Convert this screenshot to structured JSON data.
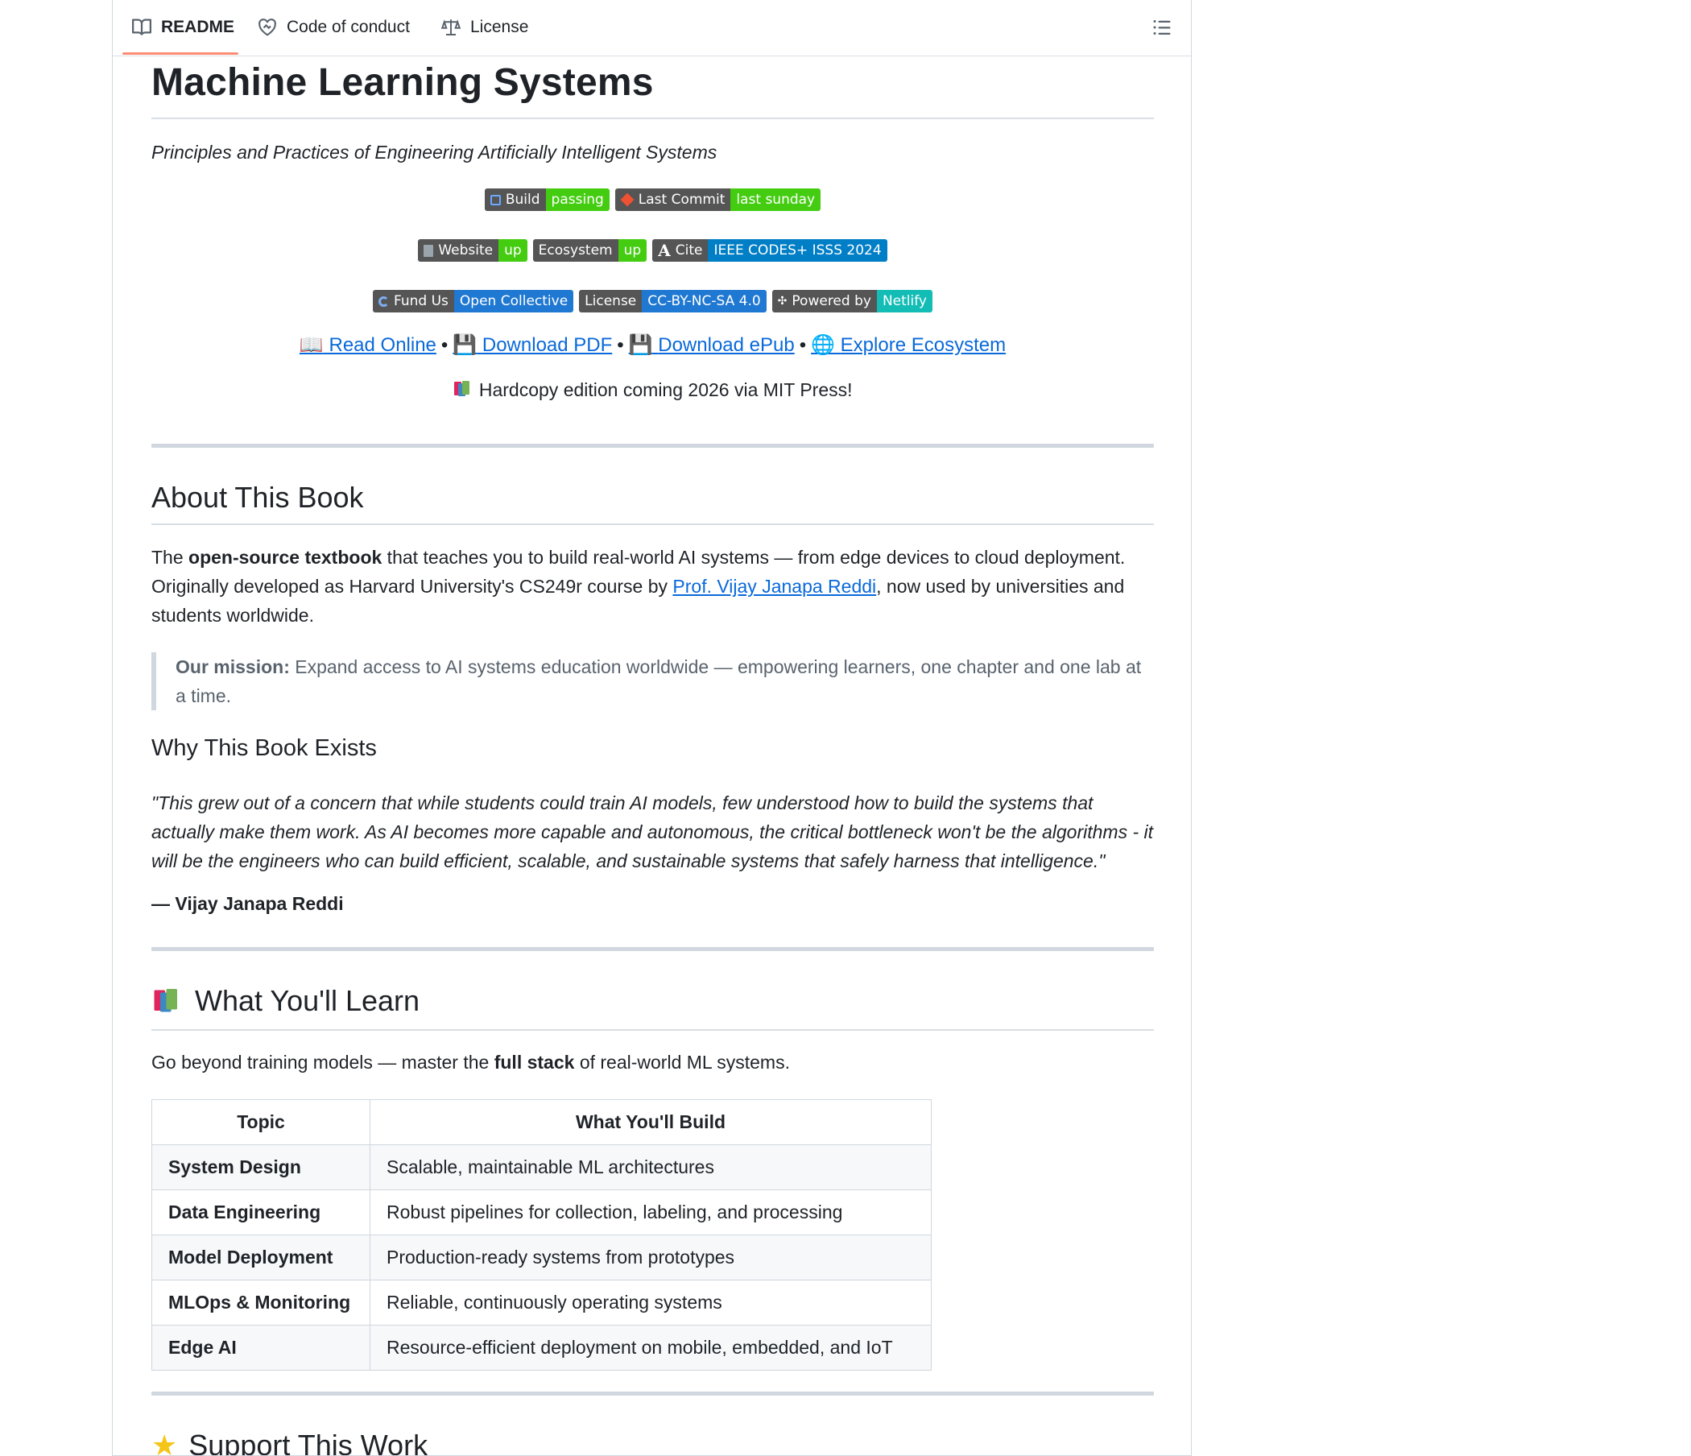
{
  "tabs": [
    {
      "label": "README",
      "icon": "book-icon",
      "active": true
    },
    {
      "label": "Code of conduct",
      "icon": "heart-handshake-icon",
      "active": false
    },
    {
      "label": "License",
      "icon": "law-scale-icon",
      "active": false
    }
  ],
  "readme": {
    "title": "Machine Learning Systems",
    "subtitle": "Principles and Practices of Engineering Artificially Intelligent Systems",
    "badges": {
      "row1": [
        {
          "label": "Build",
          "value": "passing",
          "color": "#4c1"
        },
        {
          "label": "Last Commit",
          "value": "last sunday",
          "color": "#4c1"
        }
      ],
      "row2": [
        {
          "label": "Website",
          "value": "up",
          "color": "#4c1"
        },
        {
          "label": "Ecosystem",
          "value": "up",
          "color": "#4c1"
        },
        {
          "label": "Cite",
          "value": "IEEE CODES+ ISSS 2024",
          "color": "#007ec6"
        }
      ],
      "row3": [
        {
          "label": "Fund Us",
          "value": "Open Collective",
          "color": "#1f78d1"
        },
        {
          "label": "License",
          "value": "CC-BY-NC-SA 4.0",
          "color": "#1f78d1"
        },
        {
          "label": "Powered by",
          "value": "Netlify",
          "color": "#13bdb6"
        }
      ]
    },
    "links": {
      "read_online": "Read Online",
      "download_pdf": "Download PDF",
      "download_epub": "Download ePub",
      "explore": "Explore Ecosystem",
      "separator": "•"
    },
    "hardcopy": "Hardcopy edition coming 2026 via MIT Press!",
    "about": {
      "heading": "About This Book",
      "p_the": "The ",
      "p_bold": "open-source textbook",
      "p_rest1": " that teaches you to build real-world AI systems — from edge devices to cloud deployment. Originally developed as Harvard University's CS249r course by ",
      "p_link": "Prof. Vijay Janapa Reddi",
      "p_rest2": ", now used by universities and students worldwide.",
      "mission_label": "Our mission:",
      "mission_text": " Expand access to AI systems education worldwide — empowering learners, one chapter and one lab at a time."
    },
    "why": {
      "heading": "Why This Book Exists",
      "quote": "\"This grew out of a concern that while students could train AI models, few understood how to build the systems that actually make them work. As AI becomes more capable and autonomous, the critical bottleneck won't be the algorithms - it will be the engineers who can build efficient, scalable, and sustainable systems that safely harness that intelligence.\"",
      "attribution": "— Vijay Janapa Reddi"
    },
    "learn": {
      "heading": "What You'll Learn",
      "intro_pre": "Go beyond training models — master the ",
      "intro_bold": "full stack",
      "intro_post": " of real-world ML systems.",
      "columns": [
        "Topic",
        "What You'll Build"
      ],
      "rows": [
        {
          "topic": "System Design",
          "build": "Scalable, maintainable ML architectures"
        },
        {
          "topic": "Data Engineering",
          "build": "Robust pipelines for collection, labeling, and processing"
        },
        {
          "topic": "Model Deployment",
          "build": "Production-ready systems from prototypes"
        },
        {
          "topic": "MLOps & Monitoring",
          "build": "Reliable, continuously operating systems"
        },
        {
          "topic": "Edge AI",
          "build": "Resource-efficient deployment on mobile, embedded, and IoT"
        }
      ]
    },
    "support": {
      "heading": "Support This Work"
    }
  }
}
